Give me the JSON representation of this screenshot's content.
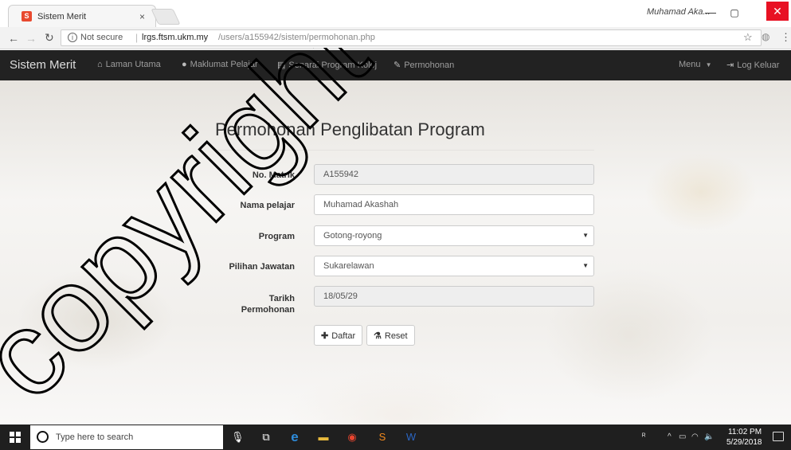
{
  "browser": {
    "tab_title": "Sistem Merit",
    "tab_close": "×",
    "window_user": "Muhamad Aka...",
    "minimize": "—",
    "maximize": "▢",
    "close": "✕",
    "security_label": "Not secure",
    "url_host": "lrgs.ftsm.ukm.my",
    "url_path": "/users/a155942/sistem/permohonan.php"
  },
  "navbar": {
    "brand": "Sistem Merit",
    "items": [
      {
        "label": "Laman Utama",
        "icon": "home-icon"
      },
      {
        "label": "Maklumat Pelajar",
        "icon": "user-icon"
      },
      {
        "label": "Senarai Program Kolej",
        "icon": "list-icon"
      },
      {
        "label": "Permohonan",
        "icon": "pencil-icon"
      }
    ],
    "menu_label": "Menu",
    "logout_label": "Log Keluar"
  },
  "form": {
    "heading": "Permohonan Penglibatan Program",
    "matrik_label": "No. Matrik",
    "matrik_value": "A155942",
    "nama_label": "Nama pelajar",
    "nama_value": "Muhamad Akashah",
    "program_label": "Program",
    "program_value": "Gotong-royong",
    "jawatan_label": "Pilihan Jawatan",
    "jawatan_value": "Sukarelawan",
    "tarikh_label_1": "Tarikh",
    "tarikh_label_2": "Permohonan",
    "tarikh_value": "18/05/29",
    "daftar_label": "Daftar",
    "reset_label": "Reset"
  },
  "watermark": "copyright",
  "taskbar": {
    "search_placeholder": "Type here to search",
    "time": "11:02 PM",
    "date": "5/29/2018"
  },
  "colors": {
    "navbar_bg": "#222222",
    "close_red": "#e81123",
    "watermark": "#000000"
  }
}
